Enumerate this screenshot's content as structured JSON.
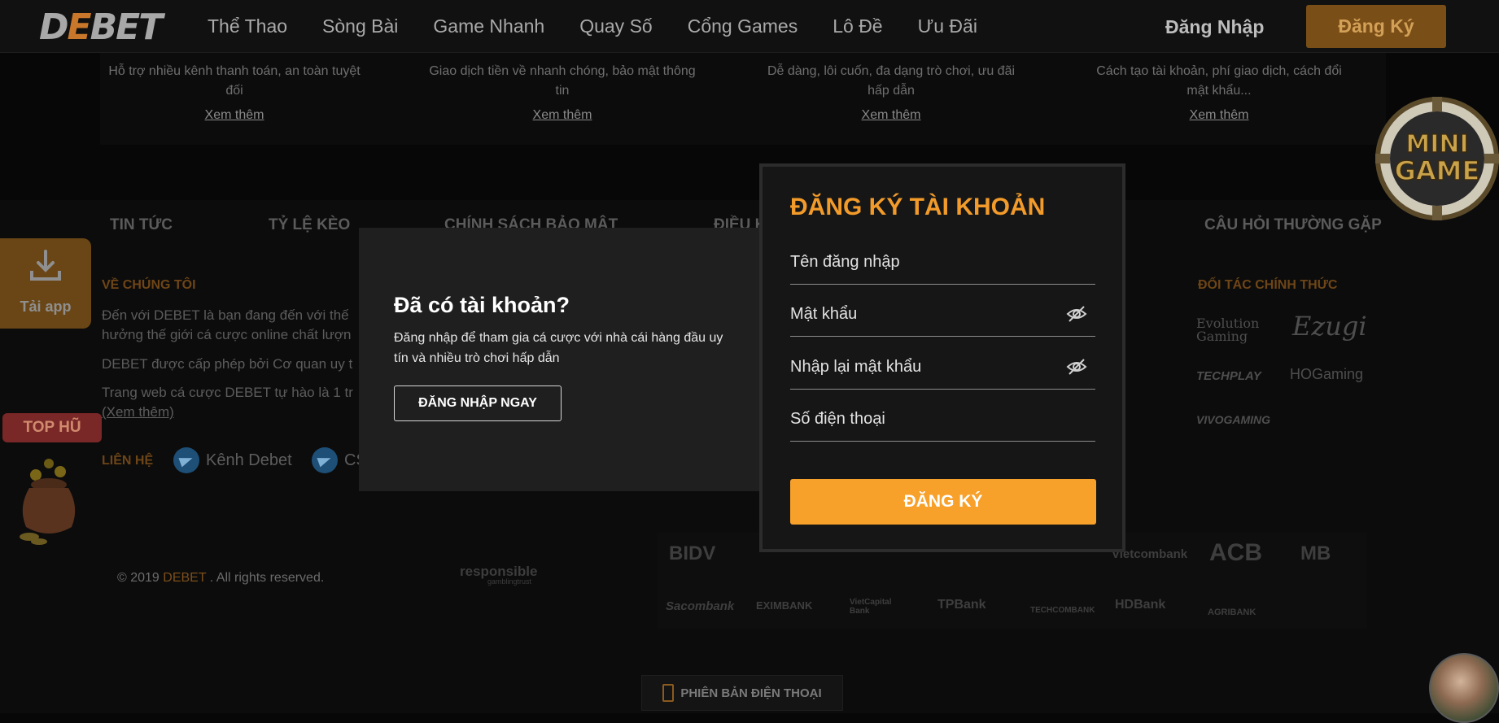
{
  "header": {
    "logo": {
      "prefix": "D",
      "accent": "E",
      "suffix": "BET"
    },
    "nav": [
      "Thể Thao",
      "Sòng Bài",
      "Game Nhanh",
      "Quay Số",
      "Cổng Games",
      "Lô Đề",
      "Ưu Đãi"
    ],
    "login_label": "Đăng Nhập",
    "register_label": "Đăng Ký"
  },
  "cards": [
    {
      "desc": "Hỗ trợ nhiều kênh thanh toán, an toàn tuyệt đối",
      "link": "Xem thêm"
    },
    {
      "desc": "Giao dịch tiền về nhanh chóng, bảo mật thông tin",
      "link": "Xem thêm"
    },
    {
      "desc": "Dễ dàng, lôi cuốn, đa dạng trò chơi, ưu đãi hấp dẫn",
      "link": "Xem thêm"
    },
    {
      "desc": "Cách tạo tài khoản, phí giao dịch, cách đổi mật khẩu...",
      "link": "Xem thêm"
    }
  ],
  "footer": {
    "nav": [
      "TIN TỨC",
      "TỶ LỆ KÈO",
      "CHÍNH SÁCH BẢO MẬT",
      "ĐIỀU K",
      "CÂU HỎI THƯỜNG GẶP"
    ],
    "about_title": "VỀ CHÚNG TÔI",
    "about_lines": [
      "Đến với DEBET là bạn đang đến với thế",
      "hưởng thế giới cá cược online chất lượn",
      "DEBET được cấp phép bởi Cơ quan uy t",
      "Trang web cá cược DEBET tự hào là 1 tr",
      "(Xem thêm)"
    ],
    "contact_title": "LIÊN HỆ",
    "contacts": [
      "Kênh Debet",
      "CS"
    ],
    "partners_title": "ĐỐI TÁC CHÍNH THỨC",
    "partners": [
      "Evolution Gaming",
      "Ezugi",
      "TECHPLAY",
      "HOGaming",
      "VIVOGAMING"
    ],
    "copyright_prefix": "© 2019",
    "copyright_brand": "DEBET",
    "copyright_suffix": ". All rights reserved.",
    "responsible": {
      "main": "responsible",
      "sub": "gamblingtrust"
    },
    "banks": [
      "BIDV",
      "Vietcombank",
      "ACB",
      "MB",
      "Sacombank",
      "EXIMBANK",
      "VietCapital Bank",
      "TPBank",
      "TECHCOMBANK",
      "HDBank",
      "AGRIBANK"
    ],
    "mobile_label": "PHIÊN BẢN ĐIỆN THOẠI"
  },
  "widgets": {
    "tai_app": "Tải app",
    "top_hu": "TOP HŨ",
    "mini_game": {
      "line1": "MINI",
      "line2": "GAME"
    }
  },
  "modal": {
    "left": {
      "title": "Đã có tài khoản?",
      "desc": "Đăng nhập để tham gia cá cược với nhà cái hàng đầu uy tín và nhiều trò chơi hấp dẫn",
      "button": "ĐĂNG NHẬP NGAY"
    },
    "right": {
      "title": "ĐĂNG KÝ TÀI KHOẢN",
      "username_placeholder": "Tên đăng nhập",
      "password_placeholder": "Mật khẩu",
      "confirm_placeholder": "Nhập lại mật khẩu",
      "phone_placeholder": "Số điện thoại",
      "submit": "ĐĂNG KÝ"
    }
  },
  "colors": {
    "accent": "#f7a02a",
    "background": "#070707",
    "modal": "#1f1f1f"
  }
}
